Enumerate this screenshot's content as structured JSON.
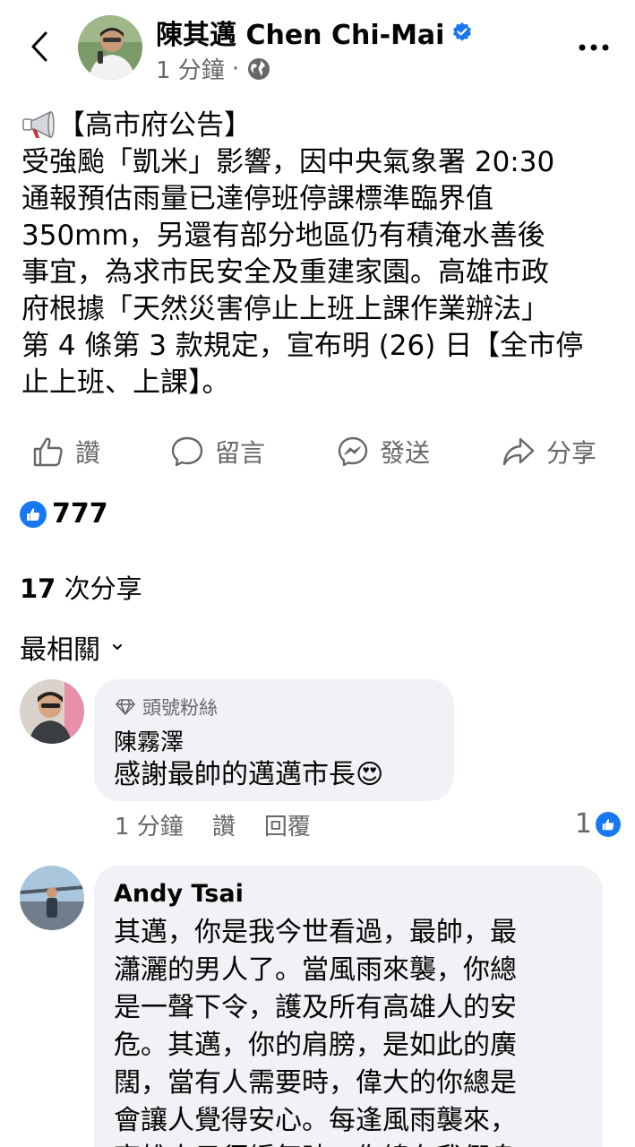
{
  "post": {
    "author": "陳其邁 Chen Chi-Mai",
    "time": "1 分鐘",
    "separator": "·",
    "lines": [
      "【高市府公告】",
      "受強颱「凱米」影響，因中央氣象署 20:30",
      "通報預估雨量已達停班停課標準臨界值",
      " 350mm，另還有部分地區仍有積淹水善後",
      "事宜，為求市民安全及重建家園。高雄市政",
      "府根據「天然災害停止上班上課作業辦法」",
      "第 4 條第 3 款規定，宣布明 (26) 日【全市停",
      "止上班、上課】。"
    ]
  },
  "actions": {
    "like": "讚",
    "comment": "留言",
    "send": "發送",
    "share": "分享"
  },
  "reactions": {
    "count": "777"
  },
  "shares": {
    "count": "17",
    "label": "次分享"
  },
  "sort": {
    "label": "最相關"
  },
  "comments": [
    {
      "badge": "頭號粉絲",
      "name": "陳霧澤",
      "text": "感謝最帥的邁邁市長",
      "emoji": "😍",
      "time": "1 分鐘",
      "like": "讚",
      "reply": "回覆",
      "reactions": "1"
    },
    {
      "name": "Andy Tsai",
      "lines": [
        "其邁，你是我今世看過，最帥，最",
        "瀟灑的男人了。當風雨來襲，你總",
        "是一聲下令，護及所有高雄人的安",
        "危。其邁，你的肩膀，是如此的廣",
        "闊，當有人需要時，偉大的你總是",
        "會讓人覺得安心。每逢風雨襲來，",
        "高雄人只須緩氣時，你總在我們身"
      ]
    }
  ],
  "colors": {
    "accent": "#1877f2",
    "muted": "#65676b",
    "bubble": "#f0f2f5"
  }
}
